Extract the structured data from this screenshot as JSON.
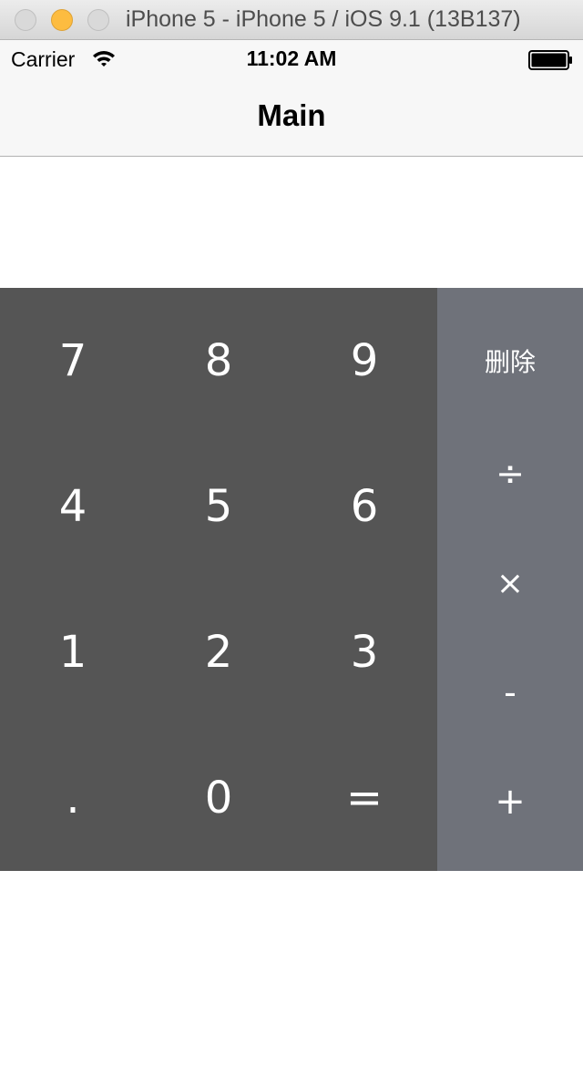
{
  "window": {
    "title": "iPhone 5 - iPhone 5 / iOS 9.1 (13B137)"
  },
  "status_bar": {
    "carrier": "Carrier",
    "time": "11:02 AM",
    "icons": [
      "wifi-icon",
      "battery-icon"
    ]
  },
  "nav": {
    "title": "Main"
  },
  "display": {
    "value": ""
  },
  "keypad": {
    "keys": [
      "7",
      "8",
      "9",
      "4",
      "5",
      "6",
      "1",
      "2",
      "3",
      ".",
      "0",
      "="
    ]
  },
  "operators": {
    "delete": "删除",
    "divide": "÷",
    "multiply": "×",
    "minus": "-",
    "plus": "+"
  },
  "colors": {
    "keypad_bg": "#555555",
    "operators_bg": "#6f727a",
    "key_text": "#ffffff"
  }
}
